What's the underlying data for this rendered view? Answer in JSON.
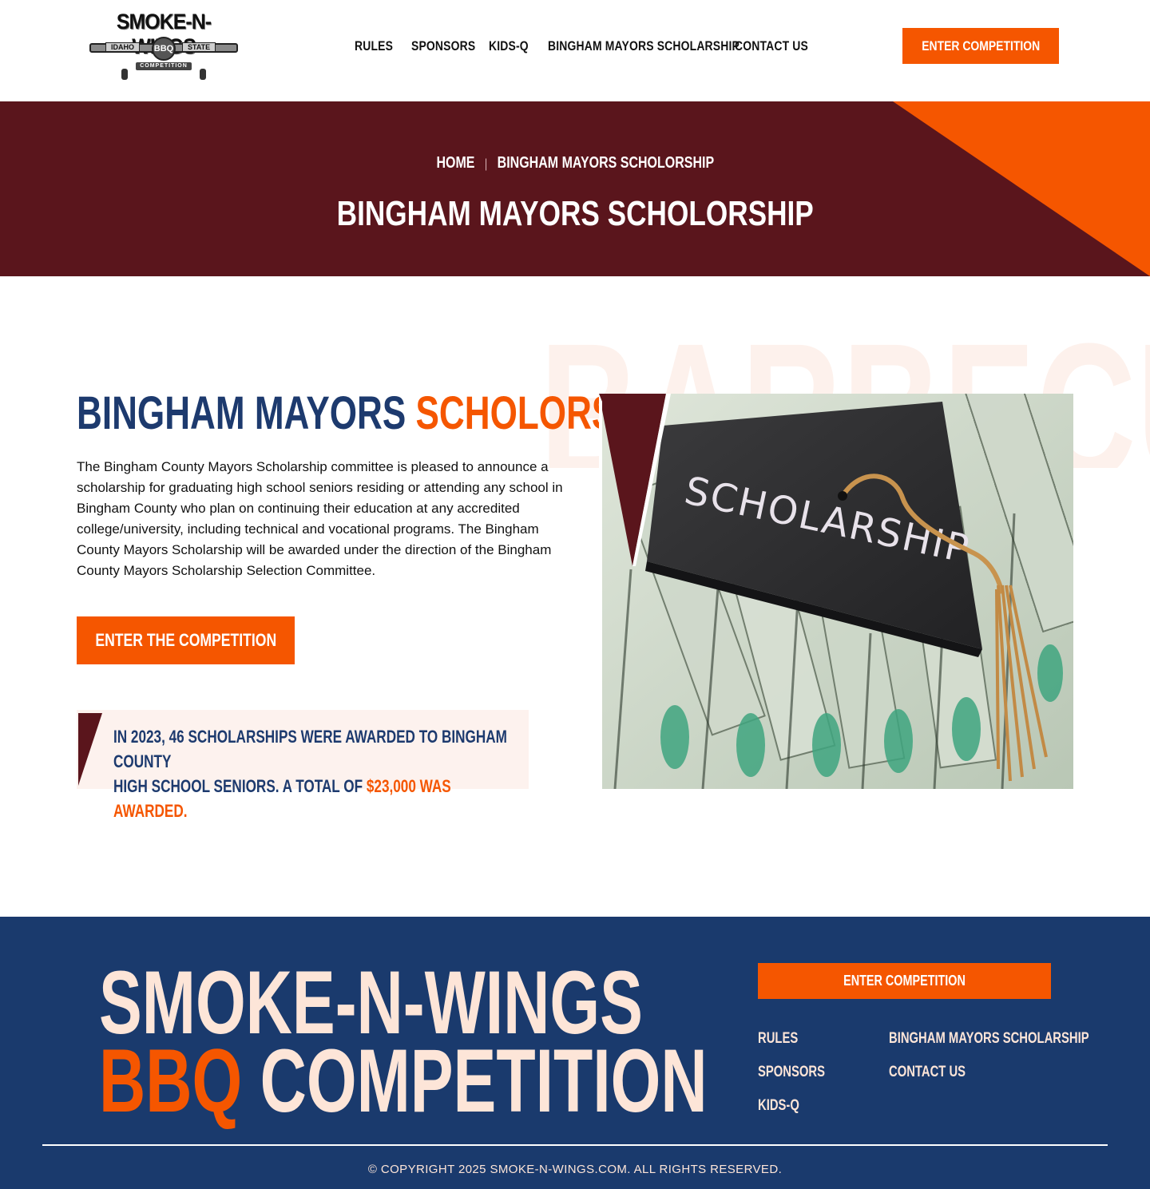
{
  "header": {
    "logo": {
      "title": "SMOKE-N-WINGS",
      "left": "IDAHO",
      "center": "BBQ",
      "right": "STATE",
      "bottom": "COMPETITION"
    },
    "nav": [
      "RULES",
      "SPONSORS",
      "KIDS-Q",
      "BINGHAM MAYORS SCHOLARSHIP",
      "CONTACT US"
    ],
    "cta": "ENTER COMPETITION"
  },
  "hero": {
    "breadcrumb_home": "HOME",
    "breadcrumb_sep": "|",
    "breadcrumb_current": "BINGHAM MAYORS SCHOLORSHIP",
    "title": "BINGHAM MAYORS SCHOLORSHIP"
  },
  "main": {
    "watermark": "BARBECUE",
    "title_a": "BINGHAM MAYORS",
    "title_b": "SCHOLORSHIP",
    "paragraph": "The Bingham County Mayors Scholarship committee is pleased to announce a scholarship for graduating high school seniors residing or attending any school in Bingham County who plan on continuing their education at any accredited college/university, including technical and vocational programs. The Bingham County Mayors Scholarship will be awarded under the direction of the Bingham County Mayors Scholarship Selection Committee.",
    "cta": "ENTER THE COMPETITION",
    "callout_line1": "IN 2023, 46 SCHOLARSHIPS WERE AWARDED TO BINGHAM COUNTY",
    "callout_line2": "HIGH SCHOOL SENIORS. A TOTAL OF",
    "callout_highlight": "$23,000 WAS AWARDED.",
    "photo_text": "SCHOLARSHIP"
  },
  "footer": {
    "big_line1": "SMOKE-N-WINGS",
    "big_line2_orange": "BBQ",
    "big_line2_rest": "COMPETITION",
    "cta": "ENTER COMPETITION",
    "links_col1": [
      "RULES",
      "SPONSORS",
      "KIDS-Q"
    ],
    "links_col2": [
      "BINGHAM MAYORS SCHOLARSHIP",
      "CONTACT US"
    ],
    "copyright": "© COPYRIGHT 2025 SMOKE-N-WINGS.COM. ALL RIGHTS RESERVED."
  },
  "colors": {
    "orange": "#f55600",
    "maroon": "#5a151c",
    "navy": "#1a3a6d",
    "title_navy": "#1d3a6e",
    "cream": "#fde5d8"
  }
}
